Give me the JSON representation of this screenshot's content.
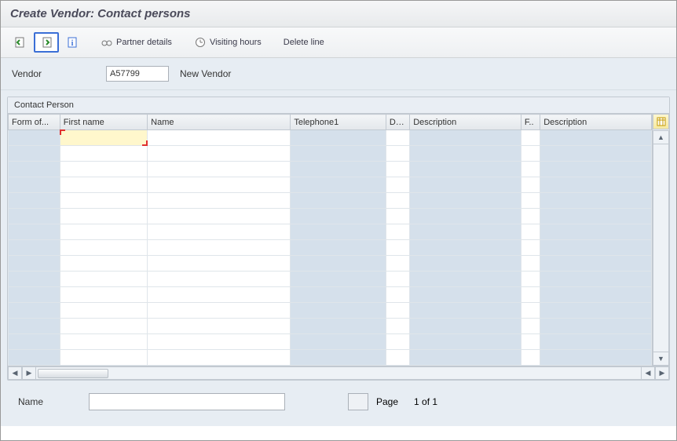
{
  "title": "Create Vendor: Contact persons",
  "toolbar": {
    "partner_details": "Partner details",
    "visiting_hours": "Visiting hours",
    "delete_line": "Delete line"
  },
  "vendor": {
    "label": "Vendor",
    "code": "A57799",
    "desc": "New Vendor"
  },
  "panel": {
    "title": "Contact Person",
    "columns": {
      "form_of": "Form of...",
      "first_name": "First name",
      "name": "Name",
      "telephone1": "Telephone1",
      "de": "De...",
      "description": "Description",
      "f": "F..",
      "description2": "Description"
    }
  },
  "footer": {
    "name_label": "Name",
    "name_value": "",
    "page_label": "Page",
    "page_text": "1 of  1"
  }
}
